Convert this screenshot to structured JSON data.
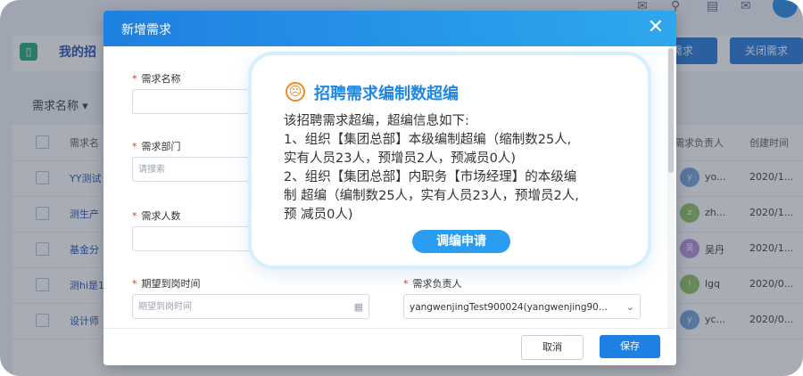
{
  "app": {
    "title": "我的招",
    "buttons": [
      "需求",
      "关闭需求"
    ]
  },
  "filter": {
    "label": "需求名称 ▾"
  },
  "table": {
    "headers": {
      "name": "需求名",
      "owner": "需求负责人",
      "created": "创建时间"
    },
    "rows": [
      {
        "name": "YY测试",
        "owner_initial": "y",
        "owner": "yo...",
        "created": "2020/1...",
        "avatar_color": "#6f9fd8"
      },
      {
        "name": "测生产",
        "owner_initial": "z",
        "owner": "zh...",
        "created": "2020/1...",
        "avatar_color": "#8fbf5a"
      },
      {
        "name": "基金分",
        "owner_initial": "吴",
        "owner": "吴丹",
        "created": "2020/1...",
        "avatar_color": "#b58ad8"
      },
      {
        "name": "测hi是1",
        "owner_initial": "l",
        "owner": "lgq",
        "created": "2020/0...",
        "avatar_color": "#8fbf5a"
      },
      {
        "name": "设计师",
        "owner_initial": "y",
        "owner": "yc...",
        "created": "2020/0...",
        "avatar_color": "#6f9fd8"
      }
    ]
  },
  "modal": {
    "title": "新增需求",
    "close": "✕",
    "fields": {
      "name_label": "需求名称",
      "dept_label": "需求部门",
      "dept_placeholder": "请搜索",
      "count_label": "需求人数",
      "date_label": "期望到岗时间",
      "date_placeholder": "期望到岗时间",
      "owner_label": "需求负责人",
      "owner_value": "yangwenjingTest900024(yangwenjing90..."
    },
    "cancel": "取消",
    "save": "保存"
  },
  "popup": {
    "title": "招聘需求编制数超编",
    "lines": [
      "该招聘需求超编，超编信息如下:",
      "1、组织【集团总部】本级编制超编（缩制数25人,",
      "实有人员23人，预增员2人，预减员0人)",
      "2、组织【集团总部】内职务【市场经理】的本级编",
      "制 超编（编制数25人，实有人员23人，预增员2人,",
      "预 减员0人)"
    ],
    "button": "调编申请"
  },
  "colors": {
    "accent": "#1e88e5",
    "warning": "#f08a24",
    "required": "#e0352b"
  }
}
